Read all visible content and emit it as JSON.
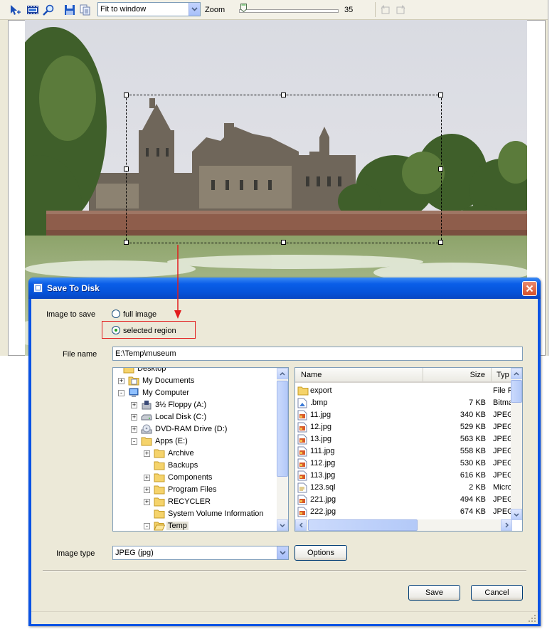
{
  "toolbar": {
    "icons": [
      "select-arrow-icon",
      "film-icon",
      "zoom-lens-icon",
      "save-disk-icon",
      "copy-pages-icon"
    ],
    "zoom_mode": "Fit to window",
    "zoom_label": "Zoom",
    "zoom_value": "35",
    "zoom_level_fraction": 0.02
  },
  "dialog": {
    "title": "Save To Disk",
    "image_to_save_label": "Image to save",
    "option_full": "full image",
    "option_region": "selected region",
    "selected_option": "selected region",
    "file_name_label": "File name",
    "file_name_value": "E:\\Temp\\museum",
    "tree": [
      {
        "label": "Desktop",
        "depth": 0,
        "expander": "",
        "icon": "folder-icon"
      },
      {
        "label": "My Documents",
        "depth": 1,
        "expander": "+",
        "icon": "my-documents-icon"
      },
      {
        "label": "My Computer",
        "depth": 1,
        "expander": "-",
        "icon": "computer-icon"
      },
      {
        "label": "3½ Floppy (A:)",
        "depth": 2,
        "expander": "+",
        "icon": "floppy-icon"
      },
      {
        "label": "Local Disk (C:)",
        "depth": 2,
        "expander": "+",
        "icon": "hard-disk-icon"
      },
      {
        "label": "DVD-RAM Drive (D:)",
        "depth": 2,
        "expander": "+",
        "icon": "dvd-drive-icon"
      },
      {
        "label": "Apps (E:)",
        "depth": 2,
        "expander": "-",
        "icon": "folder-icon"
      },
      {
        "label": "Archive",
        "depth": 3,
        "expander": "+",
        "icon": "folder-icon"
      },
      {
        "label": "Backups",
        "depth": 3,
        "expander": "",
        "icon": "folder-icon"
      },
      {
        "label": "Components",
        "depth": 3,
        "expander": "+",
        "icon": "folder-icon"
      },
      {
        "label": "Program Files",
        "depth": 3,
        "expander": "+",
        "icon": "folder-icon"
      },
      {
        "label": "RECYCLER",
        "depth": 3,
        "expander": "+",
        "icon": "folder-icon"
      },
      {
        "label": "System Volume Information",
        "depth": 3,
        "expander": "",
        "icon": "folder-icon"
      },
      {
        "label": "Temp",
        "depth": 3,
        "expander": "-",
        "icon": "open-folder-icon"
      }
    ],
    "columns": {
      "name": "Name",
      "size": "Size",
      "type": "Typ"
    },
    "files": [
      {
        "name": "export",
        "size": "",
        "type": "File F",
        "icon": "folder-icon"
      },
      {
        "name": ".bmp",
        "size": "7 KB",
        "type": "Bitmap",
        "icon": "bitmap-file-icon"
      },
      {
        "name": "11.jpg",
        "size": "340 KB",
        "type": "JPEG",
        "icon": "jpeg-file-icon"
      },
      {
        "name": "12.jpg",
        "size": "529 KB",
        "type": "JPEG",
        "icon": "jpeg-file-icon"
      },
      {
        "name": "13.jpg",
        "size": "563 KB",
        "type": "JPEG",
        "icon": "jpeg-file-icon"
      },
      {
        "name": "111.jpg",
        "size": "558 KB",
        "type": "JPEG",
        "icon": "jpeg-file-icon"
      },
      {
        "name": "112.jpg",
        "size": "530 KB",
        "type": "JPEG",
        "icon": "jpeg-file-icon"
      },
      {
        "name": "113.jpg",
        "size": "616 KB",
        "type": "JPEG",
        "icon": "jpeg-file-icon"
      },
      {
        "name": "123.sql",
        "size": "2 KB",
        "type": "Micro",
        "icon": "sql-file-icon"
      },
      {
        "name": "221.jpg",
        "size": "494 KB",
        "type": "JPEG",
        "icon": "jpeg-file-icon"
      },
      {
        "name": "222.jpg",
        "size": "674 KB",
        "type": "JPEG",
        "icon": "jpeg-file-icon"
      }
    ],
    "image_type_label": "Image type",
    "image_type_value": "JPEG (jpg)",
    "options_button": "Options",
    "save_button": "Save",
    "cancel_button": "Cancel"
  },
  "colors": {
    "title_blue": "#0553d9",
    "dialog_bg": "#ece9d8",
    "highlight_red": "#e21c1c",
    "radio_dot": "#21a121"
  }
}
